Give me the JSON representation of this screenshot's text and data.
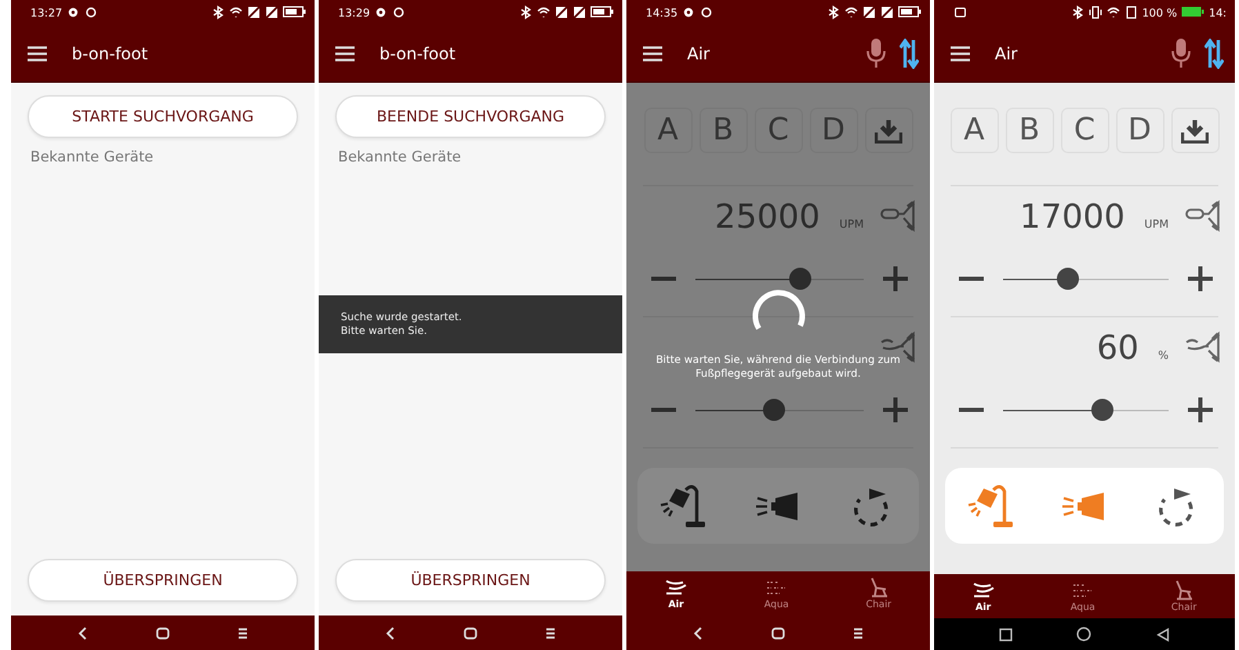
{
  "screens": [
    {
      "kind": "scan",
      "status_bar": {
        "time": "13:27"
      },
      "app_bar": {
        "title": "b-on-foot"
      },
      "scan_button": "STARTE SUCHVORGANG",
      "section_label": "Bekannte Geräte",
      "skip_button": "ÜBERSPRINGEN",
      "nav_bar": {
        "kind": "classic"
      }
    },
    {
      "kind": "scan",
      "status_bar": {
        "time": "13:29"
      },
      "app_bar": {
        "title": "b-on-foot"
      },
      "scan_button": "BEENDE SUCHVORGANG",
      "section_label": "Bekannte Geräte",
      "toast": [
        "Suche wurde gestartet.",
        "Bitte warten Sie."
      ],
      "skip_button": "ÜBERSPRINGEN",
      "nav_bar": {
        "kind": "classic"
      }
    },
    {
      "kind": "control",
      "status_bar": {
        "time": "14:35"
      },
      "app_bar": {
        "title": "Air"
      },
      "presets": [
        "A",
        "B",
        "C",
        "D"
      ],
      "controls": [
        {
          "value": "25000",
          "unit": "UPM",
          "level": 0.62
        },
        {
          "level": 0.47
        }
      ],
      "tool_buttons": [
        {
          "kind": "lamp",
          "on": false
        },
        {
          "kind": "spray",
          "on": false
        },
        {
          "kind": "rotate",
          "on": false
        }
      ],
      "overlay": {
        "message": "Bitte warten Sie, während die Verbindung zum Fußpflegegerät aufgebaut wird."
      },
      "tabs": [
        {
          "kind": "air",
          "label": "Air",
          "selected": true
        },
        {
          "kind": "aqua",
          "label": "Aqua",
          "selected": false
        },
        {
          "kind": "chair",
          "label": "Chair",
          "selected": false
        }
      ],
      "nav_bar": {
        "kind": "classic"
      }
    },
    {
      "kind": "control",
      "status_bar": {
        "time": "14:",
        "battery": "100 %"
      },
      "app_bar": {
        "title": "Air"
      },
      "presets": [
        "A",
        "B",
        "C",
        "D"
      ],
      "controls": [
        {
          "value": "17000",
          "unit": "UPM",
          "level": 0.39
        },
        {
          "value": "60",
          "unit": "%",
          "level": 0.6
        }
      ],
      "tool_buttons": [
        {
          "kind": "lamp",
          "on": true
        },
        {
          "kind": "spray",
          "on": true
        },
        {
          "kind": "rotate",
          "on": false
        }
      ],
      "tabs": [
        {
          "kind": "air",
          "label": "Air",
          "selected": true
        },
        {
          "kind": "aqua",
          "label": "Aqua",
          "selected": false
        },
        {
          "kind": "chair",
          "label": "Chair",
          "selected": false
        }
      ],
      "nav_bar": {
        "kind": "modern"
      }
    }
  ]
}
